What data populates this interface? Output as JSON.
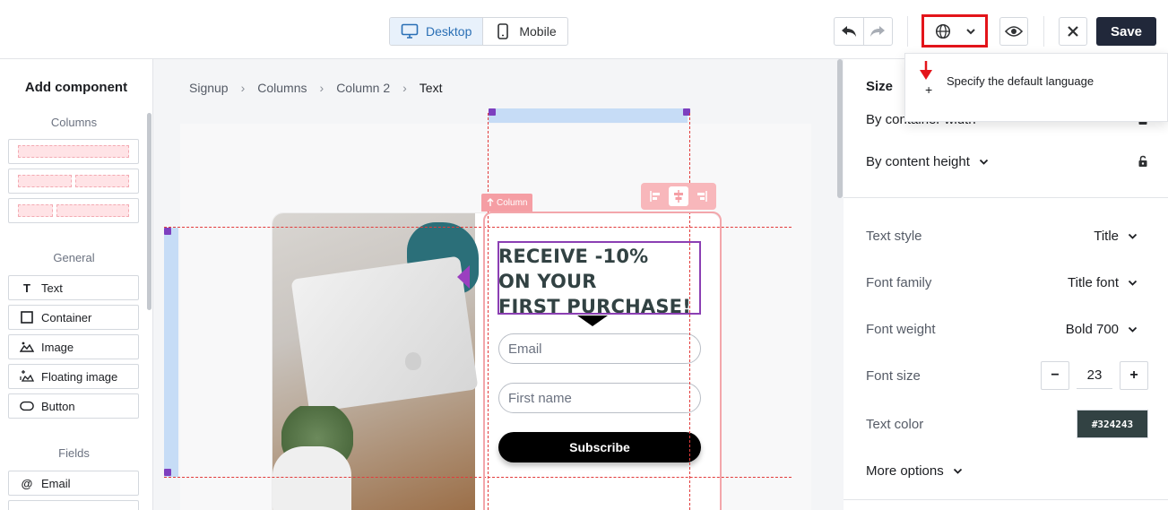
{
  "toolbar": {
    "device_desktop": "Desktop",
    "device_mobile": "Mobile",
    "save_label": "Save"
  },
  "tooltip": {
    "text": "Specify the default language",
    "plus": "+"
  },
  "left_panel": {
    "title": "Add component",
    "sections": {
      "columns": "Columns",
      "general": "General",
      "fields": "Fields"
    },
    "general_items": [
      {
        "label": "Text",
        "icon": "text-icon"
      },
      {
        "label": "Container",
        "icon": "container-icon"
      },
      {
        "label": "Image",
        "icon": "image-icon"
      },
      {
        "label": "Floating image",
        "icon": "floating-image-icon"
      },
      {
        "label": "Button",
        "icon": "button-icon"
      }
    ],
    "field_items": [
      {
        "label": "Email",
        "icon": "at-icon"
      }
    ]
  },
  "breadcrumb": {
    "items": [
      "Signup",
      "Columns",
      "Column 2"
    ],
    "current": "Text",
    "separator": "›"
  },
  "popup": {
    "headline_lines": [
      "RECEIVE -10%",
      "ON YOUR",
      "FIRST PURCHASE!"
    ],
    "email_placeholder": "Email",
    "first_name_placeholder": "First name",
    "subscribe_label": "Subscribe",
    "column_tag": "Column"
  },
  "right_panel": {
    "size_title": "Size",
    "width_mode": "By container width",
    "height_mode": "By content height",
    "text_style_label": "Text style",
    "text_style_value": "Title",
    "font_family_label": "Font family",
    "font_family_value": "Title font",
    "font_weight_label": "Font weight",
    "font_weight_value": "Bold 700",
    "font_size_label": "Font size",
    "font_size_value": "23",
    "text_color_label": "Text color",
    "text_color_value": "#324243",
    "more_options": "More options",
    "minus": "−",
    "plus": "+"
  },
  "colors": {
    "accent": "#2a6fb5",
    "save_bg": "#21283a",
    "highlight_red": "#e3141a",
    "text_color": "#324243"
  }
}
